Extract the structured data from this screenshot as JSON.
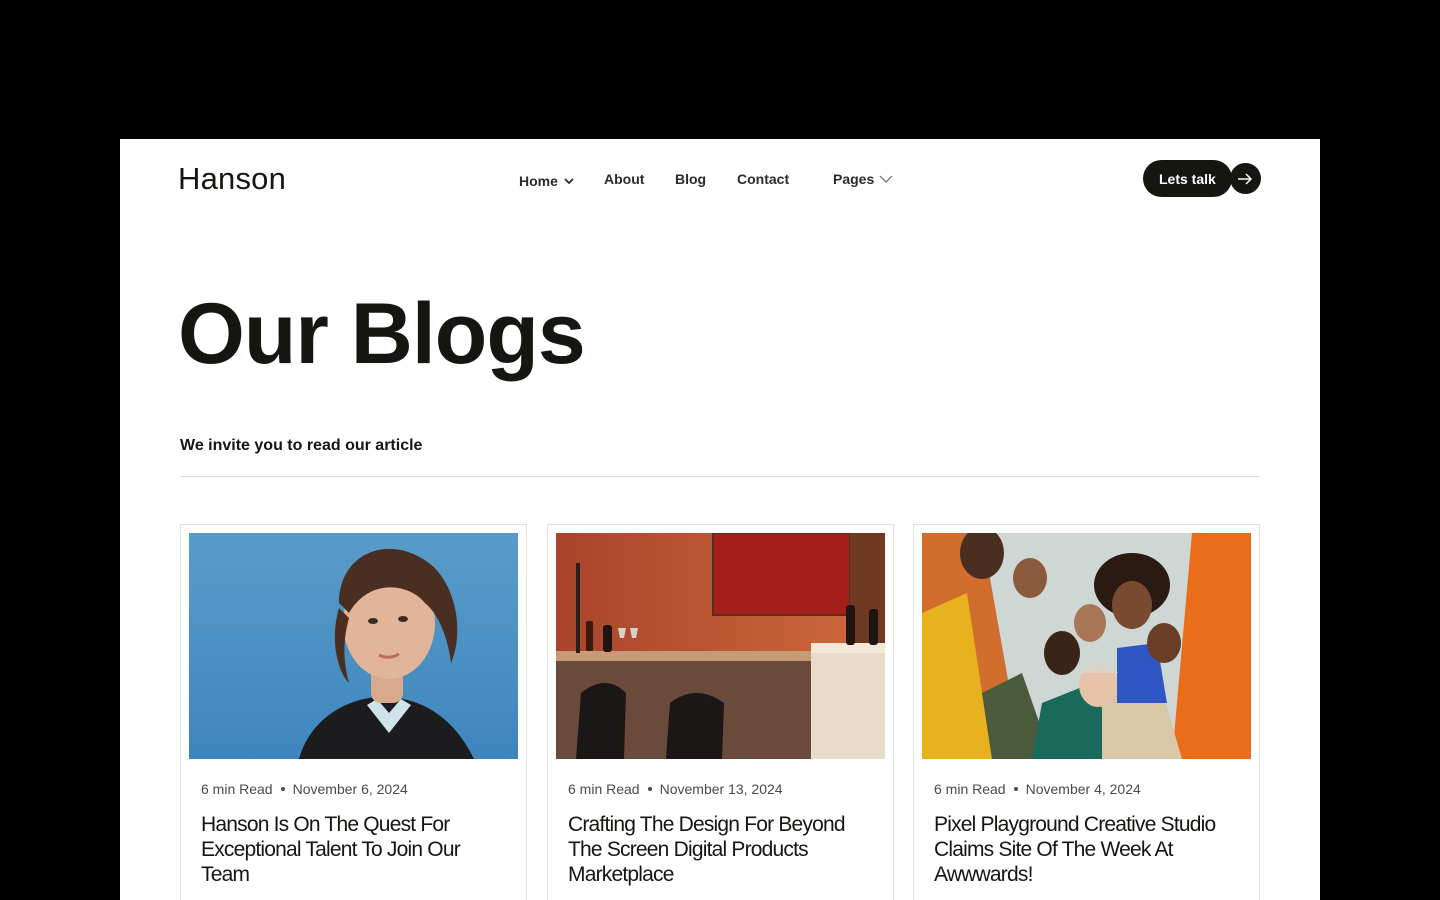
{
  "header": {
    "logo": "Hanson",
    "nav": [
      {
        "label": "Home",
        "has_dropdown": true
      },
      {
        "label": "About",
        "has_dropdown": false
      },
      {
        "label": "Blog",
        "has_dropdown": false
      },
      {
        "label": "Contact",
        "has_dropdown": false
      },
      {
        "label": "Pages",
        "has_dropdown": true
      }
    ],
    "cta_label": "Lets talk",
    "cta_icon": "arrow-right-icon"
  },
  "hero": {
    "title": "Our Blogs",
    "subtitle": "We invite you to read our article"
  },
  "posts": [
    {
      "read_time": "6 min Read",
      "date": "November 6, 2024",
      "title": "Hanson Is On The Quest For Exceptional Talent To Join Our Team",
      "image": "portrait-woman-blue-background"
    },
    {
      "read_time": "6 min Read",
      "date": "November 13, 2024",
      "title": "Crafting The Design For Beyond The Screen Digital Products Marketplace",
      "image": "orange-interior-bar-counter"
    },
    {
      "read_time": "6 min Read",
      "date": "November 4, 2024",
      "title": "Pixel Playground Creative Studio Claims Site Of The Week At Awwwards!",
      "image": "group-people-low-angle-sky"
    }
  ],
  "colors": {
    "background": "#000000",
    "surface": "#ffffff",
    "ink": "#15160f",
    "divider": "#dedede"
  }
}
